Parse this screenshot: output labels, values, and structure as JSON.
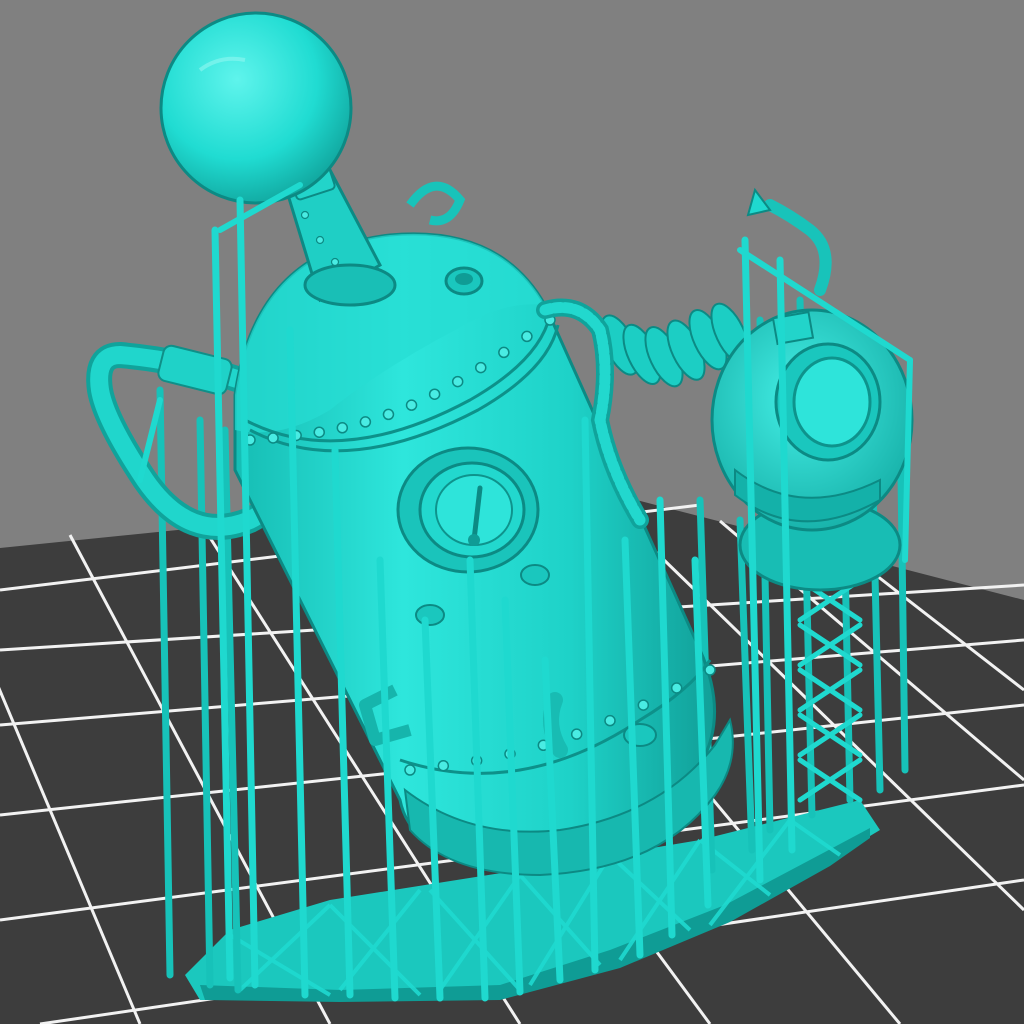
{
  "viewport": {
    "background_color": "#808080",
    "build_plate": {
      "color": "#3d3d3d",
      "grid_line_color": "#f2f2f2"
    }
  },
  "model": {
    "color": "#1fd9cf",
    "shadow_color": "#0f8f88",
    "highlight_color": "#7ff2ec",
    "parts": [
      "boiler-tank",
      "globe-top",
      "boiler-neck",
      "porthole-gauge",
      "diving-helmet",
      "helmet-porthole",
      "coiled-hose",
      "side-pipe",
      "riveted-bands",
      "support-structures",
      "raft-base"
    ]
  },
  "icons": [
    "pressure-gauge-icon"
  ]
}
